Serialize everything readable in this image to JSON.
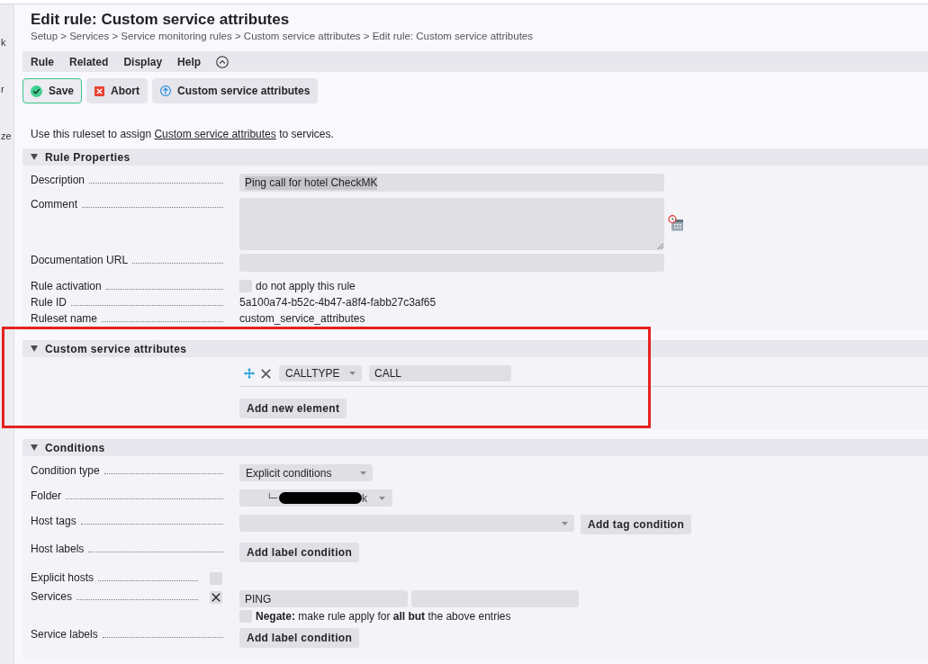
{
  "sidebar": {
    "items": [
      "k",
      "r",
      "ze"
    ]
  },
  "header": {
    "title": "Edit rule: Custom service attributes",
    "breadcrumb": "Setup > Services > Service monitoring rules > Custom service attributes > Edit rule: Custom service attributes"
  },
  "menu_bar": {
    "items": [
      "Rule",
      "Related",
      "Display",
      "Help"
    ]
  },
  "actions": [
    {
      "kind": "save",
      "label": "Save",
      "primary": true
    },
    {
      "kind": "abort",
      "label": "Abort",
      "primary": false
    },
    {
      "kind": "ruleset",
      "label": "Custom service attributes",
      "primary": false
    }
  ],
  "intro": {
    "before": "Use this ruleset to assign",
    "link": "Custom service attributes",
    "after": "to services."
  },
  "sections": [
    {
      "kind": "form",
      "title": "Rule Properties",
      "expanded": true,
      "highlighted": false,
      "rows": [
        {
          "kind": "input",
          "label": "Description",
          "value": "Ping call for hotel CheckMK",
          "text_highlighted": true
        },
        {
          "kind": "textarea",
          "label": "Comment"
        },
        {
          "kind": "input",
          "label": "Documentation URL"
        },
        {
          "kind": "checkbox",
          "label": "Rule activation",
          "checked": false,
          "checkbox_label": "do not apply this rule"
        },
        {
          "kind": "text",
          "label": "Rule ID",
          "value": "5a100a74-b52c-4b47-a8f4-fabb27c3af65"
        },
        {
          "kind": "text",
          "label": "Ruleset name",
          "value": "custom_service_attributes"
        }
      ]
    },
    {
      "kind": "element_list",
      "title": "Custom service attributes",
      "expanded": true,
      "highlighted": true,
      "elements": [
        {
          "attribute": "CALLTYPE",
          "value": "CALL"
        }
      ],
      "add_button": "Add new element"
    },
    {
      "kind": "form",
      "title": "Conditions",
      "expanded": true,
      "highlighted": false,
      "rows": [
        {
          "kind": "select",
          "label": "Condition type",
          "value": "Explicit conditions"
        },
        {
          "kind": "folder_select",
          "label": "Folder",
          "prefix": "└─",
          "suffix": "k",
          "redacted": true
        },
        {
          "kind": "tag_select",
          "label": "Host tags",
          "button": "Add tag condition"
        },
        {
          "kind": "button",
          "label": "Host labels",
          "button": "Add label condition"
        },
        {
          "kind": "toggle_list",
          "label": "Explicit hosts",
          "checked": false
        },
        {
          "kind": "toggle_list",
          "label": "Services",
          "checked": true,
          "values": [
            "PING"
          ],
          "negate": {
            "checked": false,
            "text": "**Negate:** make rule apply for **all but** the above entries"
          }
        },
        {
          "kind": "button",
          "label": "Service labels",
          "button": "Add label condition"
        }
      ]
    }
  ]
}
